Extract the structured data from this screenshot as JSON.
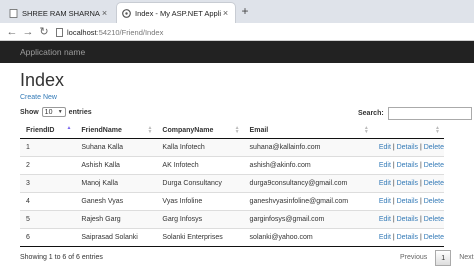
{
  "browser": {
    "tabs": [
      {
        "title": "SHREE RAM SHARNAM - Interne",
        "active": false
      },
      {
        "title": "Index - My ASP.NET Application",
        "active": true
      }
    ],
    "url_host": "localhost",
    "url_path": ":54210/Friend/Index"
  },
  "navbar": {
    "brand": "Application name"
  },
  "page": {
    "title": "Index",
    "create_link": "Create New",
    "length": {
      "show": "Show",
      "value": "10",
      "entries": "entries"
    },
    "search_label": "Search:",
    "search_value": ""
  },
  "table": {
    "headers": [
      "FriendID",
      "FriendName",
      "CompanyName",
      "Email",
      ""
    ],
    "rows": [
      {
        "id": "1",
        "name": "Suhana Kalla",
        "company": "Kalla Infotech",
        "email": "suhana@kallainfo.com"
      },
      {
        "id": "2",
        "name": "Ashish Kalla",
        "company": "AK Infotech",
        "email": "ashish@akinfo.com"
      },
      {
        "id": "3",
        "name": "Manoj Kalla",
        "company": "Durga Consultancy",
        "email": "durga9consultancy@gmail.com"
      },
      {
        "id": "4",
        "name": "Ganesh Vyas",
        "company": "Vyas Infoline",
        "email": "ganeshvyasinfoline@gmail.com"
      },
      {
        "id": "5",
        "name": "Rajesh Garg",
        "company": "Garg Infosys",
        "email": "garginfosys@gmail.com"
      },
      {
        "id": "6",
        "name": "Saiprasad Solanki",
        "company": "Solanki Enterprises",
        "email": "solanki@yahoo.com"
      }
    ],
    "actions": {
      "edit": "Edit",
      "details": "Details",
      "delete": "Delete",
      "sep": " | "
    }
  },
  "footer": {
    "info": "Showing 1 to 6 of 6 entries",
    "previous": "Previous",
    "current_page": "1",
    "next": "Next"
  },
  "colors": {
    "navbar": "#222222",
    "link": "#337ab7",
    "sort_active": "#7b68ee"
  }
}
